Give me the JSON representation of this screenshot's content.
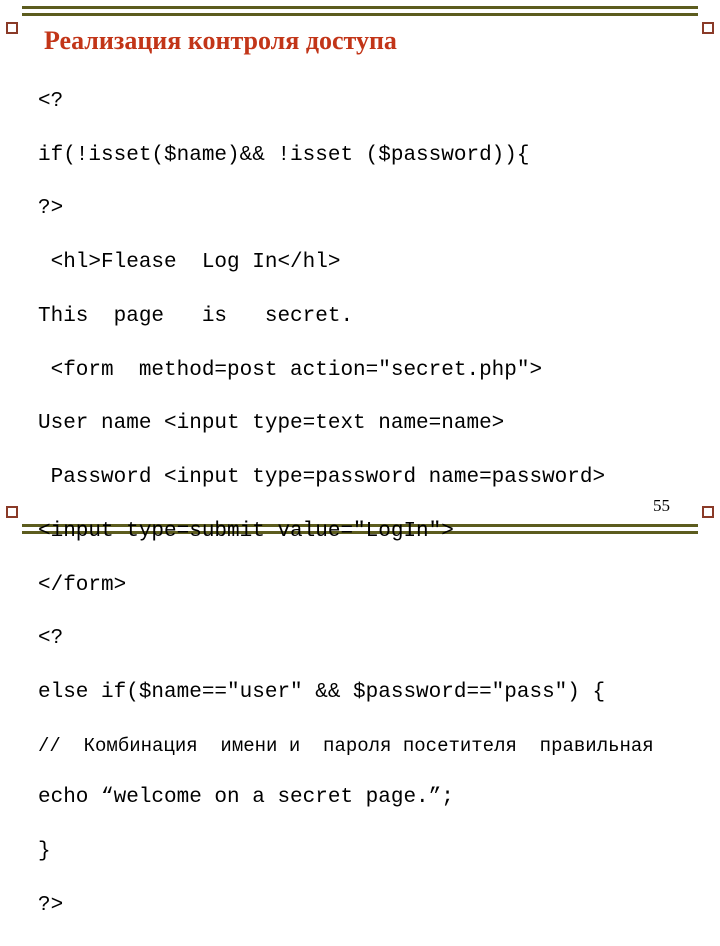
{
  "title": "Реализация контроля доступа",
  "code": {
    "l1": "<?",
    "l2": "if(!isset($name)&& !isset ($password)){",
    "l3": "?>",
    "l4": " <hl>Flease  Log In</hl>",
    "l5": "This  page   is   secret.",
    "l6": " <form  method=post action=\"secret.php\">",
    "l7": "User name <input type=text name=name>",
    "l8": " Password <input type=password name=password>",
    "l9": "<input type=submit value=\"LogIn\">",
    "l10": "</form>",
    "l11": "<?",
    "l12": "else if($name==\"user\" && $password==\"pass\") {",
    "l13": "//  Комбинация  имени и  пароля посетителя  правильная",
    "l14": "echo “welcome on a secret page.”;",
    "l15": "}",
    "l16": "?>"
  },
  "page_number": "55"
}
